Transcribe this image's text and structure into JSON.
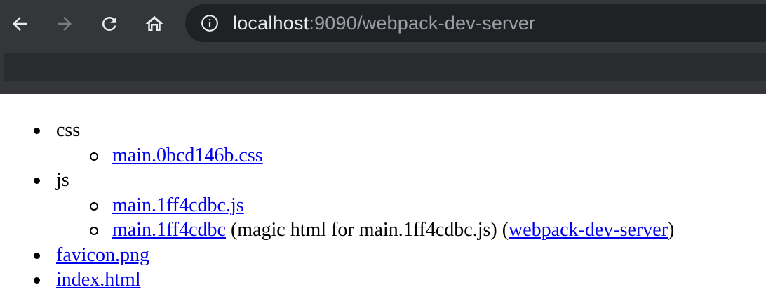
{
  "browser": {
    "url_host": "localhost",
    "url_rest": ":9090/webpack-dev-server",
    "colors": {
      "toolbar": "#35363a",
      "omnibox": "#202124",
      "link": "#0000ee"
    }
  },
  "listing": {
    "css": {
      "label": "css",
      "files": [
        "main.0bcd146b.css"
      ]
    },
    "js": {
      "label": "js",
      "file1": "main.1ff4cdbc.js",
      "file2": "main.1ff4cdbc",
      "file2_note": "(magic html for main.1ff4cdbc.js) (",
      "file2_devserver_link": "webpack-dev-server",
      "file2_close": ")"
    },
    "favicon": "favicon.png",
    "index": "index.html"
  }
}
